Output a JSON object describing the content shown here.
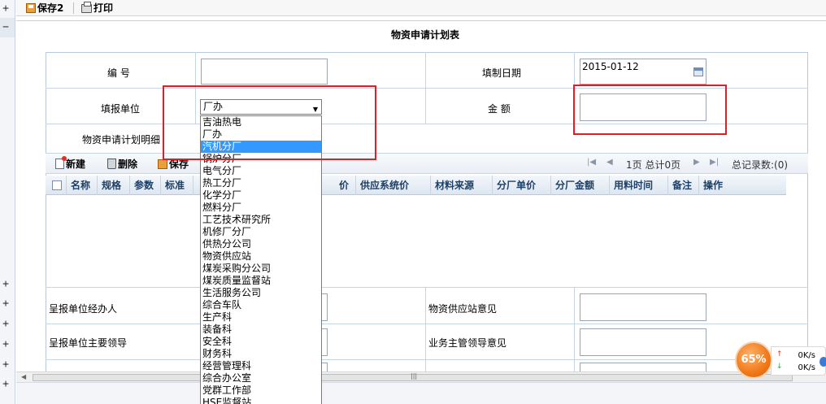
{
  "toolbar": {
    "save_label": "保存2",
    "print_label": "打印"
  },
  "form": {
    "title": "物资申请计划表",
    "fields": {
      "code_label": "编    号",
      "code_value": "",
      "fill_date_label": "填制日期",
      "fill_date_value": "2015-01-12",
      "report_unit_label": "填报单位",
      "report_unit_value": "厂办",
      "amount_label": "金    额",
      "amount_value": "",
      "detail_label": "物资申请计划明细"
    },
    "grid": {
      "toolbar": {
        "new_label": "新建",
        "delete_label": "删除",
        "save_label": "保存"
      },
      "pager": {
        "page_info": "1页 总计0页",
        "total_records": "总记录数:(0)"
      },
      "columns": [
        "名称",
        "规格",
        "参数",
        "标准",
        "价",
        "供应系统价",
        "材料来源",
        "分厂单价",
        "分厂金额",
        "用料时间",
        "备注",
        "操作"
      ]
    },
    "bottom": {
      "handler_label": "呈报单位经办人",
      "handler_value": "",
      "leader_label": "呈报单位主要领导",
      "leader_value": "",
      "supply_opinion_label": "物资供应站意见",
      "supply_opinion_value": "",
      "business_opinion_label": "业务主管领导意见",
      "business_opinion_value": ""
    }
  },
  "dropdown": {
    "selected_index": 2,
    "options": [
      "吉油热电",
      "厂办",
      "汽机分厂",
      "锅炉分厂",
      "电气分厂",
      "热工分厂",
      "化学分厂",
      "燃料分厂",
      "工艺技术研究所",
      "机修厂分厂",
      "供热分公司",
      "物资供应站",
      "煤炭采购分公司",
      "煤炭质量监督站",
      "生活服务公司",
      "综合车队",
      "生产科",
      "装备科",
      "安全科",
      "财务科",
      "经营管理科",
      "综合办公室",
      "党群工作部",
      "HSE监督站"
    ]
  },
  "left_strip": {
    "buttons": [
      "+",
      "−",
      "+",
      "+",
      "+",
      "+",
      "+",
      "+"
    ]
  },
  "speed_widget": {
    "percent": "65%",
    "upload": "0K/s",
    "download": "0K/s"
  },
  "colors": {
    "annotation_red": "#e31d23",
    "selected_option": "#3399ff",
    "header_text": "#1e3f66",
    "speed_orange": "#f07818"
  }
}
